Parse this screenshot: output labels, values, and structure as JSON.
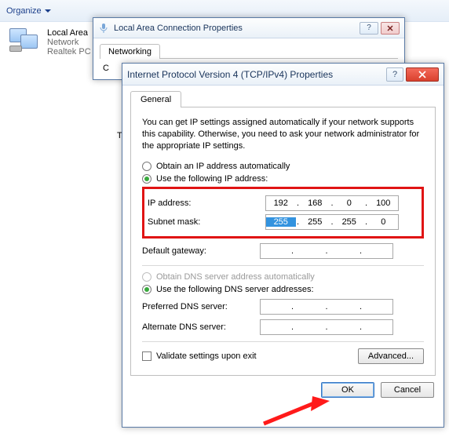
{
  "explorer": {
    "organize": "Organize",
    "nic": {
      "name": "Local Area",
      "line2": "Network",
      "line3": "Realtek PC"
    }
  },
  "lan_window": {
    "title": "Local Area Connection Properties",
    "tab_networking": "Networking",
    "partial": "C"
  },
  "left_frag": "T",
  "ipv4": {
    "title": "Internet Protocol Version 4 (TCP/IPv4) Properties",
    "tab_general": "General",
    "description": "You can get IP settings assigned automatically if your network supports this capability. Otherwise, you need to ask your network administrator for the appropriate IP settings.",
    "radio_ip_auto": "Obtain an IP address automatically",
    "radio_ip_manual": "Use the following IP address:",
    "label_ip": "IP address:",
    "label_subnet": "Subnet mask:",
    "label_gateway": "Default gateway:",
    "ip": {
      "o1": "192",
      "o2": "168",
      "o3": "0",
      "o4": "100"
    },
    "subnet": {
      "o1": "255",
      "o2": "255",
      "o3": "255",
      "o4": "0"
    },
    "gateway": {
      "o1": "",
      "o2": "",
      "o3": "",
      "o4": ""
    },
    "radio_dns_auto": "Obtain DNS server address automatically",
    "radio_dns_manual": "Use the following DNS server addresses:",
    "label_pref_dns": "Preferred DNS server:",
    "label_alt_dns": "Alternate DNS server:",
    "pref_dns": {
      "o1": "",
      "o2": "",
      "o3": "",
      "o4": ""
    },
    "alt_dns": {
      "o1": "",
      "o2": "",
      "o3": "",
      "o4": ""
    },
    "validate": "Validate settings upon exit",
    "advanced": "Advanced...",
    "ok": "OK",
    "cancel": "Cancel"
  }
}
